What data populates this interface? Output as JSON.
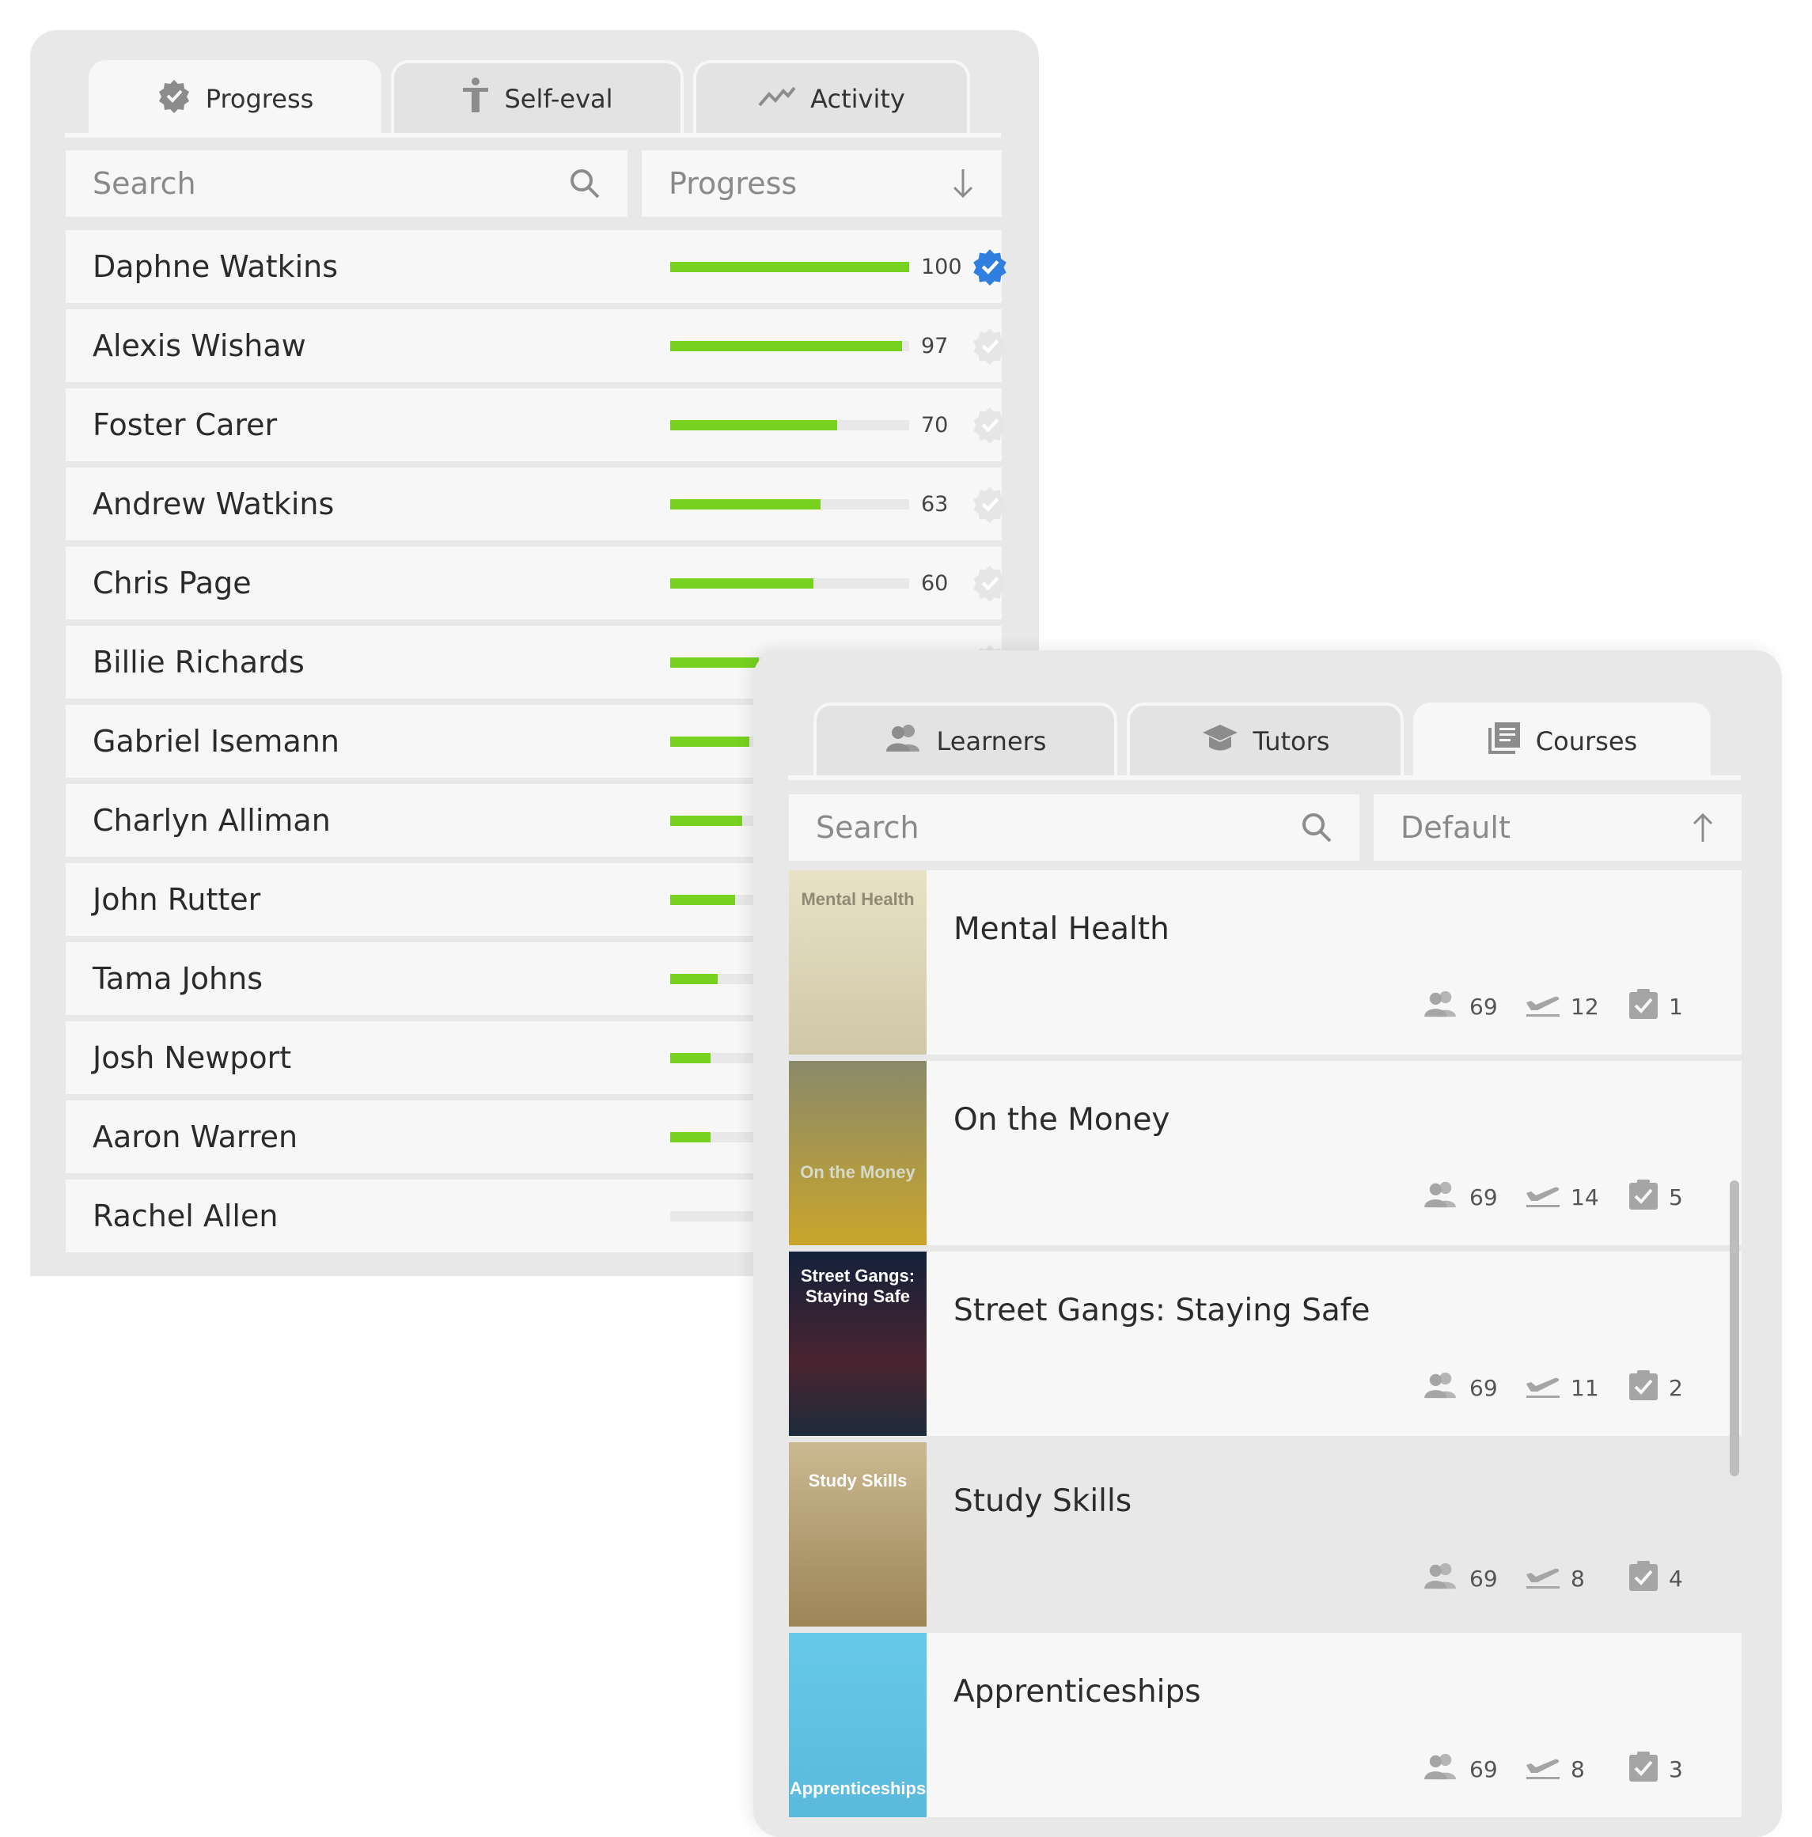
{
  "progress_panel": {
    "tabs": [
      {
        "label": "Progress",
        "icon": "badge-check-icon",
        "active": true
      },
      {
        "label": "Self-eval",
        "icon": "accessibility-icon",
        "active": false
      },
      {
        "label": "Activity",
        "icon": "activity-line-icon",
        "active": false
      }
    ],
    "search_placeholder": "Search",
    "sort_label": "Progress",
    "learners": [
      {
        "name": "Daphne Watkins",
        "progress": 100,
        "label": "100",
        "complete": true
      },
      {
        "name": "Alexis Wishaw",
        "progress": 97,
        "label": "97",
        "complete": false
      },
      {
        "name": "Foster Carer",
        "progress": 70,
        "label": "70",
        "complete": false
      },
      {
        "name": "Andrew Watkins",
        "progress": 63,
        "label": "63",
        "complete": false
      },
      {
        "name": "Chris Page",
        "progress": 60,
        "label": "60",
        "complete": false
      },
      {
        "name": "Billie Richards",
        "progress": 37,
        "label": "",
        "complete": false
      },
      {
        "name": "Gabriel Isemann",
        "progress": 33,
        "label": "",
        "complete": false
      },
      {
        "name": "Charlyn Alliman",
        "progress": 30,
        "label": "",
        "complete": false
      },
      {
        "name": "John Rutter",
        "progress": 27,
        "label": "",
        "complete": false
      },
      {
        "name": "Tama Johns",
        "progress": 20,
        "label": "",
        "complete": false
      },
      {
        "name": "Josh Newport",
        "progress": 17,
        "label": "",
        "complete": false
      },
      {
        "name": "Aaron Warren",
        "progress": 17,
        "label": "",
        "complete": false
      },
      {
        "name": "Rachel Allen",
        "progress": 0,
        "label": "",
        "complete": false
      }
    ],
    "colors": {
      "bar_fill": "#77d11f",
      "bar_track": "#e8e8e8",
      "complete_badge": "#2f7fe0",
      "incomplete_badge": "#e6e6e6"
    }
  },
  "courses_panel": {
    "tabs": [
      {
        "label": "Learners",
        "icon": "users-icon",
        "active": false
      },
      {
        "label": "Tutors",
        "icon": "graduation-cap-icon",
        "active": false
      },
      {
        "label": "Courses",
        "icon": "book-stack-icon",
        "active": true
      }
    ],
    "search_placeholder": "Search",
    "sort_label": "Default",
    "courses": [
      {
        "title": "Mental Health",
        "thumb_text": "Mental Health",
        "learners": "69",
        "departures": "12",
        "completed": "1",
        "highlight": false
      },
      {
        "title": "On the Money",
        "thumb_text": "On the Money",
        "learners": "69",
        "departures": "14",
        "completed": "5",
        "highlight": false
      },
      {
        "title": "Street Gangs: Staying Safe",
        "thumb_text": "Street Gangs: Staying Safe",
        "learners": "69",
        "departures": "11",
        "completed": "2",
        "highlight": false
      },
      {
        "title": "Study Skills",
        "thumb_text": "Study Skills",
        "learners": "69",
        "departures": "8",
        "completed": "4",
        "highlight": true
      },
      {
        "title": "Apprenticeships",
        "thumb_text": "Apprenticeships",
        "learners": "69",
        "departures": "8",
        "completed": "3",
        "highlight": false
      }
    ]
  }
}
